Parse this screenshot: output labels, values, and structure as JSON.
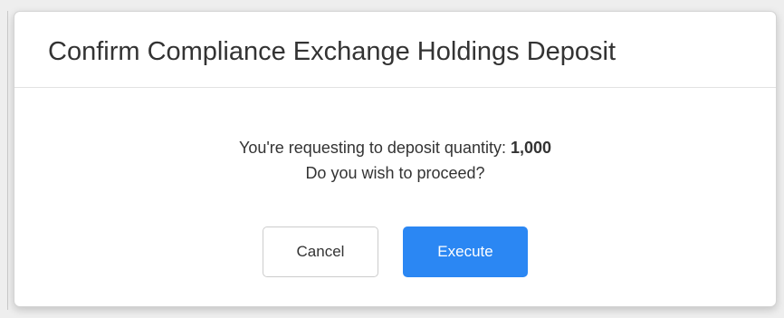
{
  "dialog": {
    "title": "Confirm Compliance Exchange Holdings Deposit",
    "message_prefix": "You're requesting to deposit quantity: ",
    "quantity": "1,000",
    "question": "Do you wish to proceed?",
    "cancel_label": "Cancel",
    "execute_label": "Execute"
  },
  "colors": {
    "primary": "#2b87f3",
    "text": "#333333"
  }
}
